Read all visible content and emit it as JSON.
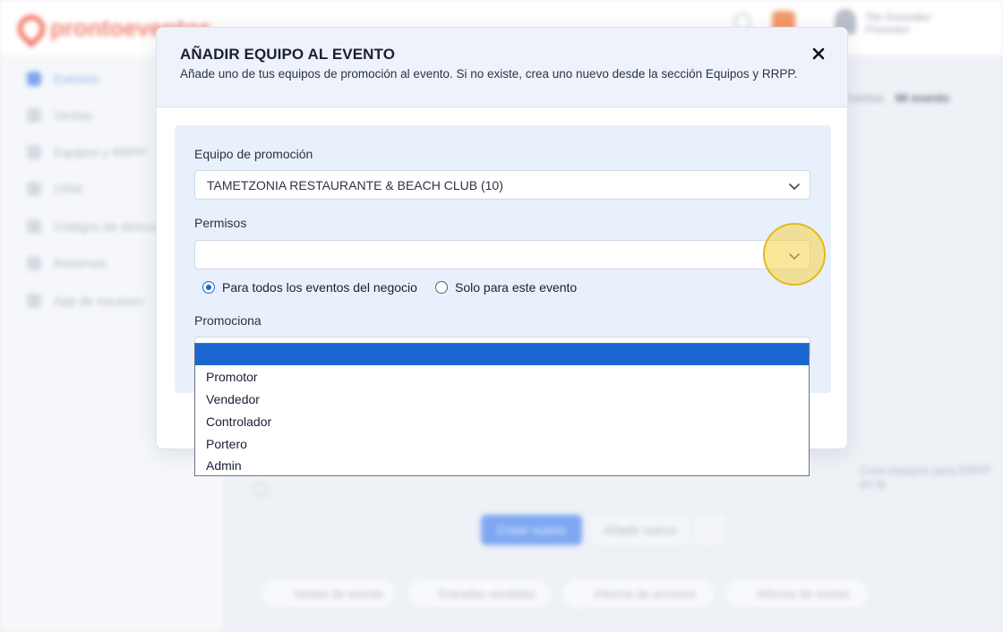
{
  "background": {
    "logo_text": "prontoeventos",
    "user": {
      "name": "Tito Gonzalez",
      "role": "Promotor"
    },
    "sidebar": [
      {
        "label": "Eventos",
        "active": true
      },
      {
        "label": "Ventas"
      },
      {
        "label": "Equipos y RRPP"
      },
      {
        "label": "CRM"
      },
      {
        "label": "Códigos de descuento"
      },
      {
        "label": "Reservas"
      },
      {
        "label": "App de escaneo"
      }
    ],
    "breadcrumb": {
      "parent": "Eventos",
      "current": "Mi evento"
    },
    "note": "Crea equipos para RRPP en la",
    "primary_button": "Crear nuevo",
    "secondary_button": "Añadir nuevo",
    "pills": [
      "Ventas de evento",
      "Entradas vendidas",
      "Informe de accesos",
      "Informe de ventas"
    ]
  },
  "modal": {
    "title": "AÑADIR EQUIPO AL EVENTO",
    "subtitle": "Añade uno de tus equipos de promoción al evento. Si no existe, crea uno nuevo desde la sección Equipos y RRPP.",
    "fields": {
      "team": {
        "label": "Equipo de promoción",
        "value": "TAMETZONIA RESTAURANTE & BEACH CLUB (10)"
      },
      "permissions": {
        "label": "Permisos",
        "value": ""
      },
      "scope": {
        "options": [
          {
            "label": "Para todos los eventos del negocio",
            "checked": true
          },
          {
            "label": "Solo para este evento",
            "checked": false
          }
        ]
      },
      "promotes": {
        "label": "Promociona"
      }
    }
  },
  "dropdown": {
    "selected": "",
    "options": [
      "Promotor",
      "Vendedor",
      "Controlador",
      "Portero",
      "Admin"
    ]
  },
  "colors": {
    "accent": "#1a66d2",
    "header_bg": "#eef3fb",
    "panel_bg": "#e8f0fb",
    "highlight": "#f6d446"
  },
  "icons": {
    "close": "close-icon",
    "chevron": "chevron-down-icon"
  }
}
